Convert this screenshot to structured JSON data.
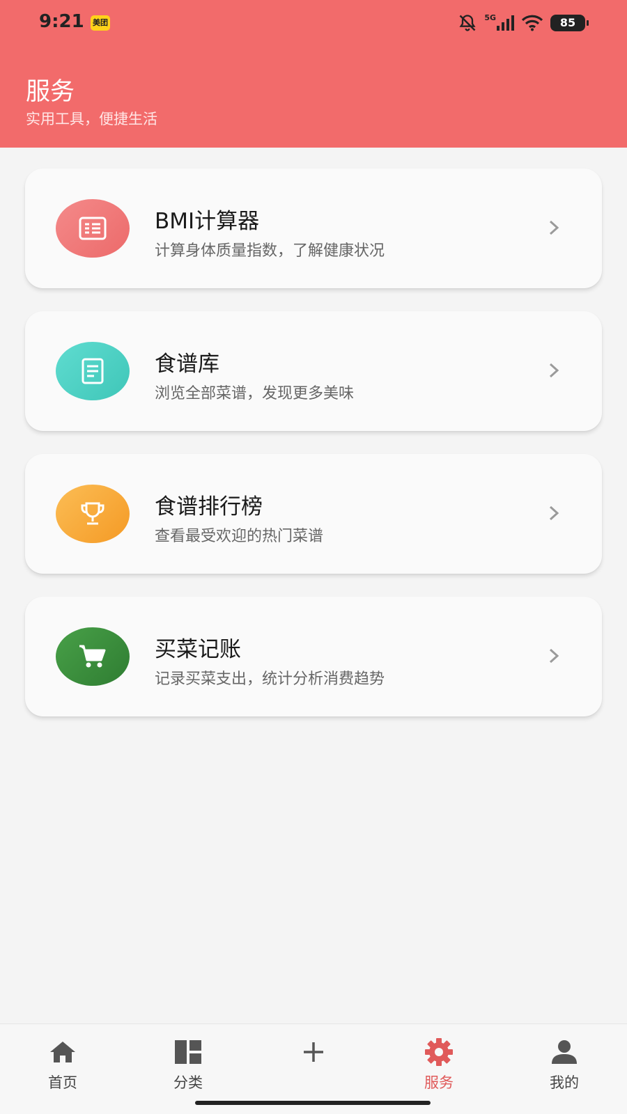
{
  "status_bar": {
    "time": "9:21",
    "app_badge": "美团",
    "network": "5G",
    "battery": "85"
  },
  "header": {
    "title": "服务",
    "subtitle": "实用工具，便捷生活",
    "color": "#f26b6b"
  },
  "services": [
    {
      "title": "BMI计算器",
      "desc": "计算身体质量指数，了解健康状况",
      "icon": "calculator-icon",
      "color": "#f07a7a"
    },
    {
      "title": "食谱库",
      "desc": "浏览全部菜谱，发现更多美味",
      "icon": "document-icon",
      "color": "#4fd1c5"
    },
    {
      "title": "食谱排行榜",
      "desc": "查看最受欢迎的热门菜谱",
      "icon": "trophy-icon",
      "color": "#f7a93b"
    },
    {
      "title": "买菜记账",
      "desc": "记录买菜支出，统计分析消费趋势",
      "icon": "cart-icon",
      "color": "#3d8f3d"
    }
  ],
  "bottom_nav": [
    {
      "label": "首页",
      "icon": "home-icon",
      "active": false
    },
    {
      "label": "分类",
      "icon": "grid-icon",
      "active": false
    },
    {
      "label": "",
      "icon": "plus-icon",
      "active": false
    },
    {
      "label": "服务",
      "icon": "gear-icon",
      "active": true
    },
    {
      "label": "我的",
      "icon": "person-icon",
      "active": false
    }
  ],
  "accent_color": "#e05a5a"
}
